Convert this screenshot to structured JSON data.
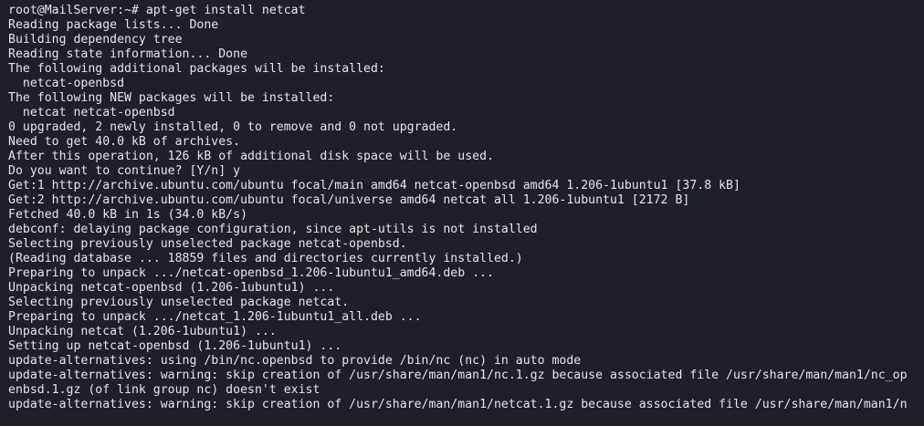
{
  "terminal": {
    "lines": [
      "root@MailServer:~# apt-get install netcat",
      "Reading package lists... Done",
      "Building dependency tree",
      "Reading state information... Done",
      "The following additional packages will be installed:",
      "  netcat-openbsd",
      "The following NEW packages will be installed:",
      "  netcat netcat-openbsd",
      "0 upgraded, 2 newly installed, 0 to remove and 0 not upgraded.",
      "Need to get 40.0 kB of archives.",
      "After this operation, 126 kB of additional disk space will be used.",
      "Do you want to continue? [Y/n] y",
      "Get:1 http://archive.ubuntu.com/ubuntu focal/main amd64 netcat-openbsd amd64 1.206-1ubuntu1 [37.8 kB]",
      "Get:2 http://archive.ubuntu.com/ubuntu focal/universe amd64 netcat all 1.206-1ubuntu1 [2172 B]",
      "Fetched 40.0 kB in 1s (34.0 kB/s)",
      "debconf: delaying package configuration, since apt-utils is not installed",
      "Selecting previously unselected package netcat-openbsd.",
      "(Reading database ... 18859 files and directories currently installed.)",
      "Preparing to unpack .../netcat-openbsd_1.206-1ubuntu1_amd64.deb ...",
      "Unpacking netcat-openbsd (1.206-1ubuntu1) ...",
      "Selecting previously unselected package netcat.",
      "Preparing to unpack .../netcat_1.206-1ubuntu1_all.deb ...",
      "Unpacking netcat (1.206-1ubuntu1) ...",
      "Setting up netcat-openbsd (1.206-1ubuntu1) ...",
      "update-alternatives: using /bin/nc.openbsd to provide /bin/nc (nc) in auto mode",
      "update-alternatives: warning: skip creation of /usr/share/man/man1/nc.1.gz because associated file /usr/share/man/man1/nc_op",
      "enbsd.1.gz (of link group nc) doesn't exist",
      "update-alternatives: warning: skip creation of /usr/share/man/man1/netcat.1.gz because associated file /usr/share/man/man1/n"
    ]
  }
}
